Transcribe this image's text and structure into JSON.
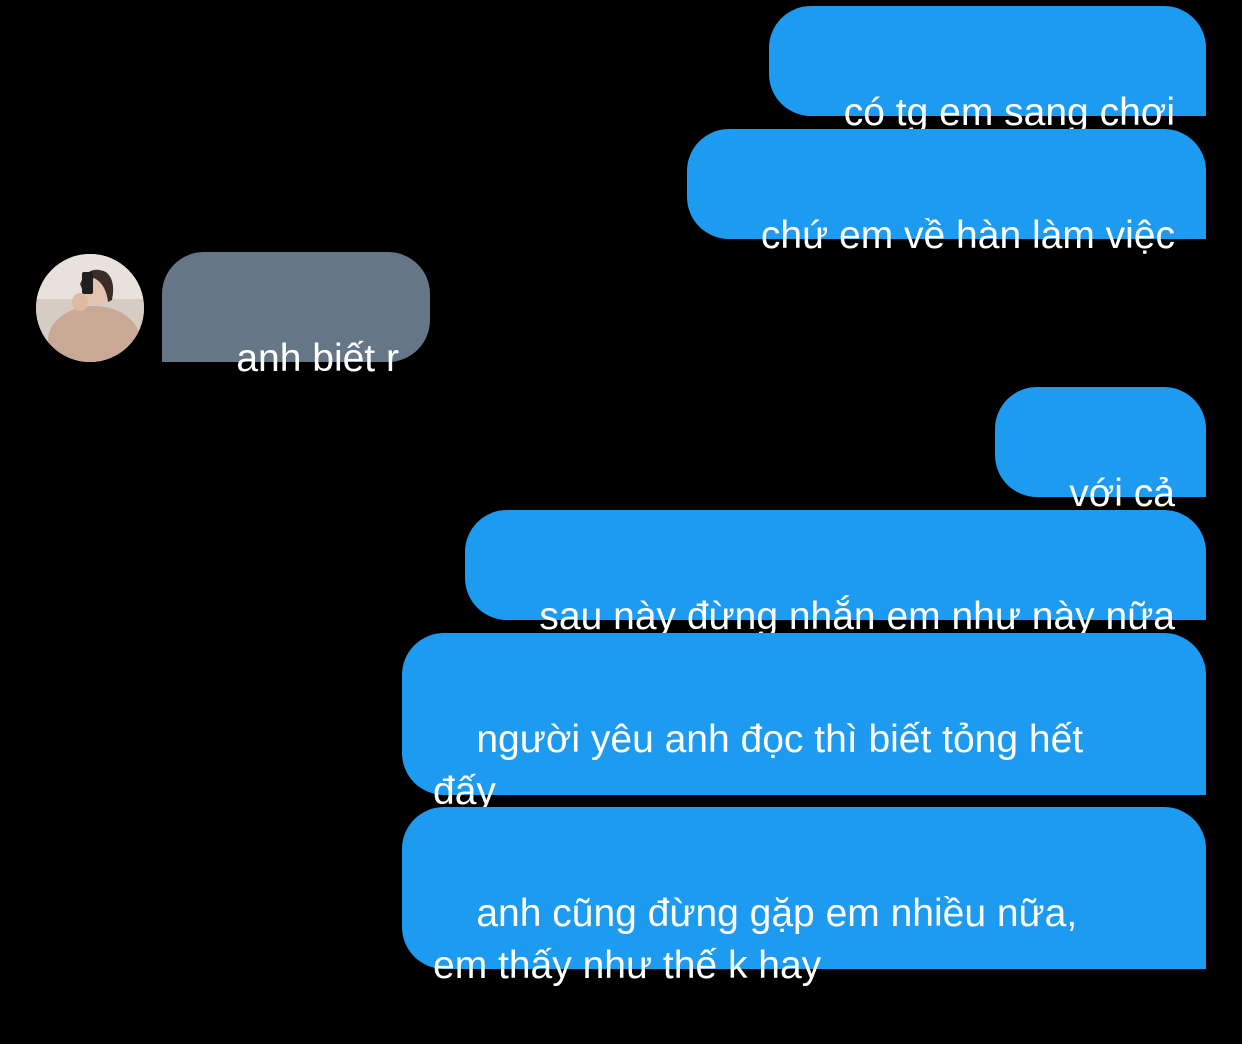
{
  "messages": [
    {
      "id": "m1",
      "direction": "outgoing",
      "text": "có tg em sang chơi"
    },
    {
      "id": "m2",
      "direction": "outgoing",
      "text": "chứ em về hàn làm việc"
    },
    {
      "id": "m3",
      "direction": "incoming",
      "text": "anh biết r",
      "sender_avatar": "avatar-photo"
    },
    {
      "id": "m4",
      "direction": "outgoing",
      "text": "với cả"
    },
    {
      "id": "m5",
      "direction": "outgoing",
      "text": "sau này đừng nhắn em như này nữa"
    },
    {
      "id": "m6",
      "direction": "outgoing",
      "text": "người yêu anh đọc thì biết tỏng hết\nđấy"
    },
    {
      "id": "m7",
      "direction": "outgoing",
      "text": "anh cũng đừng gặp em nhiều nữa,\nem thấy như thế k hay"
    }
  ],
  "colors": {
    "background": "#000000",
    "outgoing_bubble": "#1d9bf0",
    "incoming_bubble": "#657786",
    "text": "#ffffff"
  }
}
